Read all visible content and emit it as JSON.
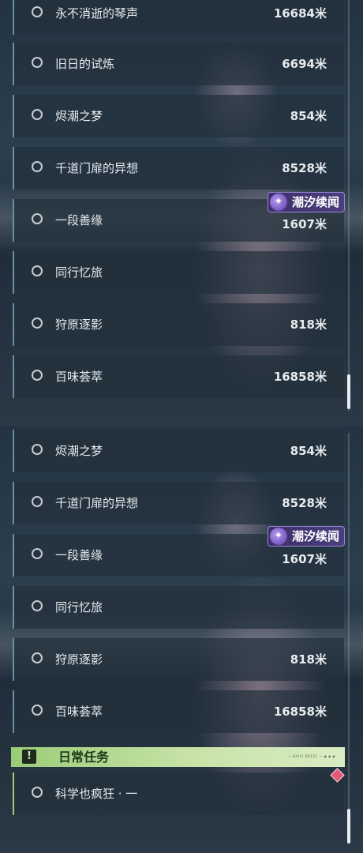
{
  "badge_text": "潮汐续闻",
  "daily": {
    "title": "日常任务",
    "fine_text": "— DAILY QUEST — ◆ ◆ ◆"
  },
  "quests_top": [
    {
      "title": "永不消逝的琴声",
      "dist": "16684米"
    },
    {
      "title": "旧日的试炼",
      "dist": "6694米"
    },
    {
      "title": "烬潮之梦",
      "dist": "854米"
    },
    {
      "title": "千道门扉的异想",
      "dist": "8528米"
    },
    {
      "title": "一段善缘",
      "dist": "1607米"
    },
    {
      "title": "同行忆旅",
      "dist": ""
    },
    {
      "title": "狩原逐影",
      "dist": "818米"
    },
    {
      "title": "百味荟萃",
      "dist": "16858米"
    }
  ],
  "quests_bottom": [
    {
      "title": "烬潮之梦",
      "dist": "854米"
    },
    {
      "title": "千道门扉的异想",
      "dist": "8528米"
    },
    {
      "title": "一段善缘",
      "dist": "1607米"
    },
    {
      "title": "同行忆旅",
      "dist": ""
    },
    {
      "title": "狩原逐影",
      "dist": "818米"
    },
    {
      "title": "百味荟萃",
      "dist": "16858米"
    }
  ],
  "daily_quest": {
    "title": "科学也疯狂 · 一"
  },
  "colors": {
    "row_accent": "#6b8fa5",
    "daily_accent": "#9bcc78",
    "badge": "#4a3f7d"
  }
}
